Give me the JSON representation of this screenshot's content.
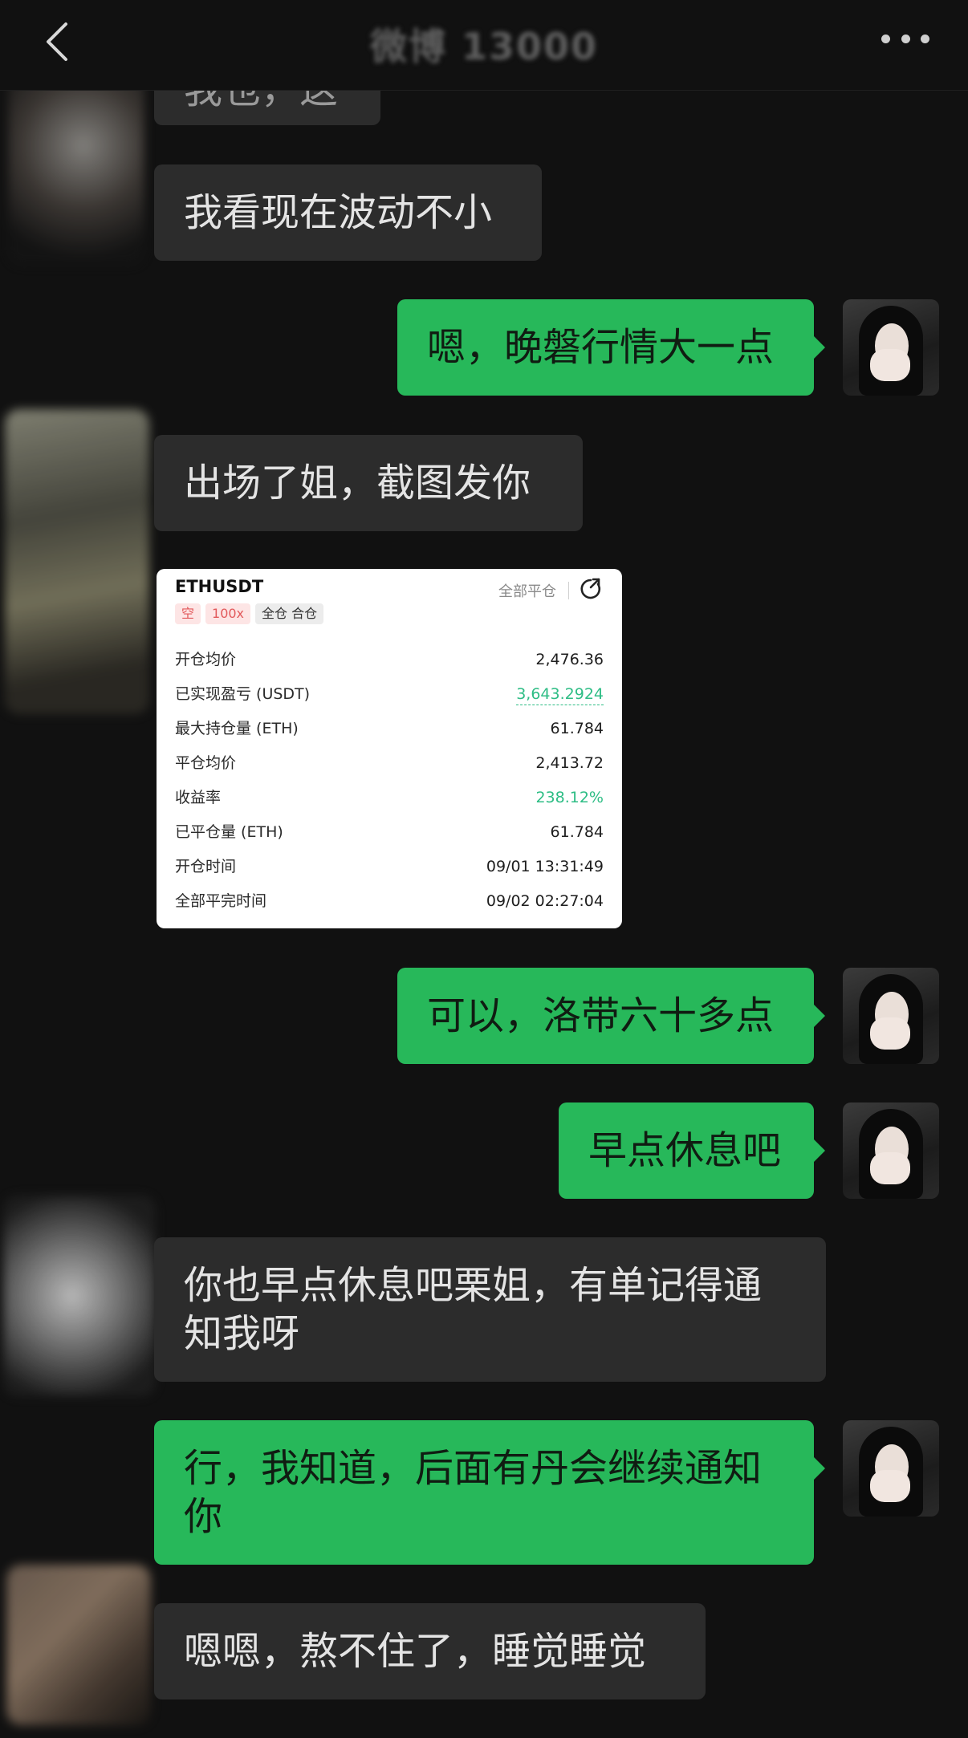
{
  "header": {
    "title": "微博 13000"
  },
  "messages": [
    {
      "id": "m0",
      "side": "in",
      "text": "我也，这"
    },
    {
      "id": "m1",
      "side": "in",
      "text": "我看现在波动不小"
    },
    {
      "id": "m2",
      "side": "out",
      "text": "嗯，晚磐行情大一点"
    },
    {
      "id": "m3",
      "side": "in",
      "text": "出场了姐，截图发你"
    },
    {
      "id": "m4",
      "side": "out",
      "text": "可以，洛带六十多点"
    },
    {
      "id": "m5",
      "side": "out",
      "text": "早点休息吧"
    },
    {
      "id": "m6",
      "side": "in",
      "text": "你也早点休息吧栗姐，有单记得通知我呀"
    },
    {
      "id": "m7",
      "side": "out",
      "text": "行，我知道，后面有丹会继续通知你"
    },
    {
      "id": "m8",
      "side": "in",
      "text": "嗯嗯，熬不住了，睡觉睡觉"
    }
  ],
  "trade_card": {
    "symbol": "ETHUSDT",
    "tags": [
      "空",
      "100x",
      "全仓 合仓"
    ],
    "close_all_label": "全部平仓",
    "rows": [
      {
        "label": "开仓均价",
        "value": "2,476.36",
        "style": "normal"
      },
      {
        "label": "已实现盈亏 (USDT)",
        "value": "3,643.2924",
        "style": "green-dashed"
      },
      {
        "label": "最大持仓量 (ETH)",
        "value": "61.784",
        "style": "normal"
      },
      {
        "label": "平仓均价",
        "value": "2,413.72",
        "style": "normal"
      },
      {
        "label": "收益率",
        "value": "238.12%",
        "style": "green"
      },
      {
        "label": "已平仓量 (ETH)",
        "value": "61.784",
        "style": "normal"
      },
      {
        "label": "开仓时间",
        "value": "09/01 13:31:49",
        "style": "normal"
      },
      {
        "label": "全部平完时间",
        "value": "09/02 02:27:04",
        "style": "normal"
      }
    ]
  },
  "colors": {
    "background": "#111111",
    "incoming_bubble": "#2c2c2c",
    "outgoing_bubble": "#27b85a",
    "profit_green": "#2ebd85",
    "short_red": "#e2595b"
  }
}
